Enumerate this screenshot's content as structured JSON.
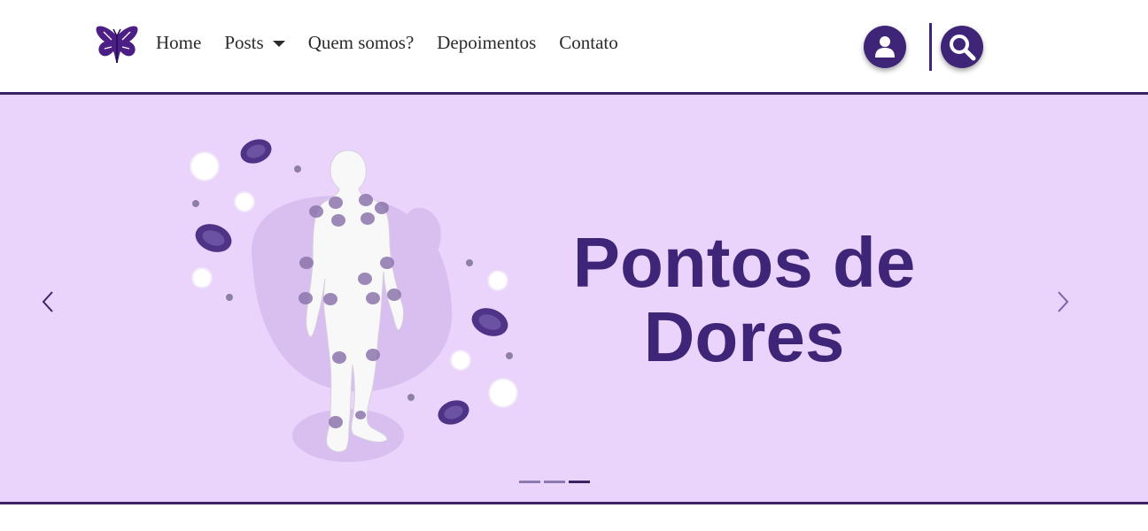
{
  "brand": {
    "logo_icon": "butterfly-icon",
    "color": "#3f2577"
  },
  "nav": {
    "items": [
      {
        "label": "Home"
      },
      {
        "label": "Posts",
        "icon": "caret-down-icon"
      },
      {
        "label": "Quem somos?"
      },
      {
        "label": "Depoimentos"
      },
      {
        "label": "Contato"
      }
    ],
    "user_icon": "user-icon",
    "search_icon": "search-icon"
  },
  "carousel": {
    "slide_title": "Pontos de Dores",
    "prev_icon": "chevron-left-icon",
    "next_icon": "chevron-right-icon",
    "indicator_count": 3,
    "active_indicator": 3,
    "background_color": "#ebd4fb",
    "title_color": "#3f2577"
  }
}
